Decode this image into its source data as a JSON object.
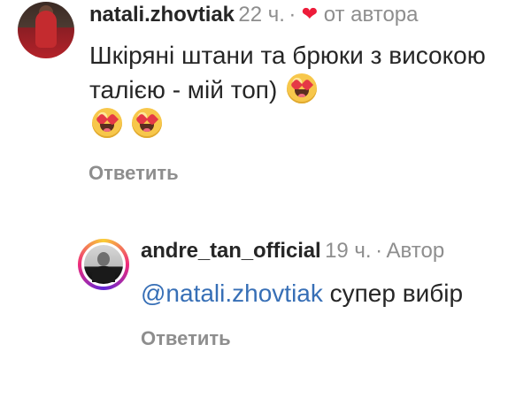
{
  "comment": {
    "username": "natali.zhovtiak",
    "time": "22 ч.",
    "separator": "·",
    "liked_by_author_label": "от автора",
    "text": "Шкіряні штани та брюки з високою талією - мій топ)",
    "reply_label": "Ответить"
  },
  "reply": {
    "username": "andre_tan_official",
    "time": "19 ч.",
    "separator": "·",
    "author_badge": "Автор",
    "mention": "@natali.zhovtiak",
    "text": " супер вибір",
    "reply_label": "Ответить"
  },
  "icons": {
    "heart": "heart-icon",
    "emoji": "heart-eyes-emoji"
  },
  "colors": {
    "heart": "#ed1c3a",
    "mention": "#376fb6",
    "secondary_text": "#8e8e8e",
    "primary_text": "#262626"
  }
}
